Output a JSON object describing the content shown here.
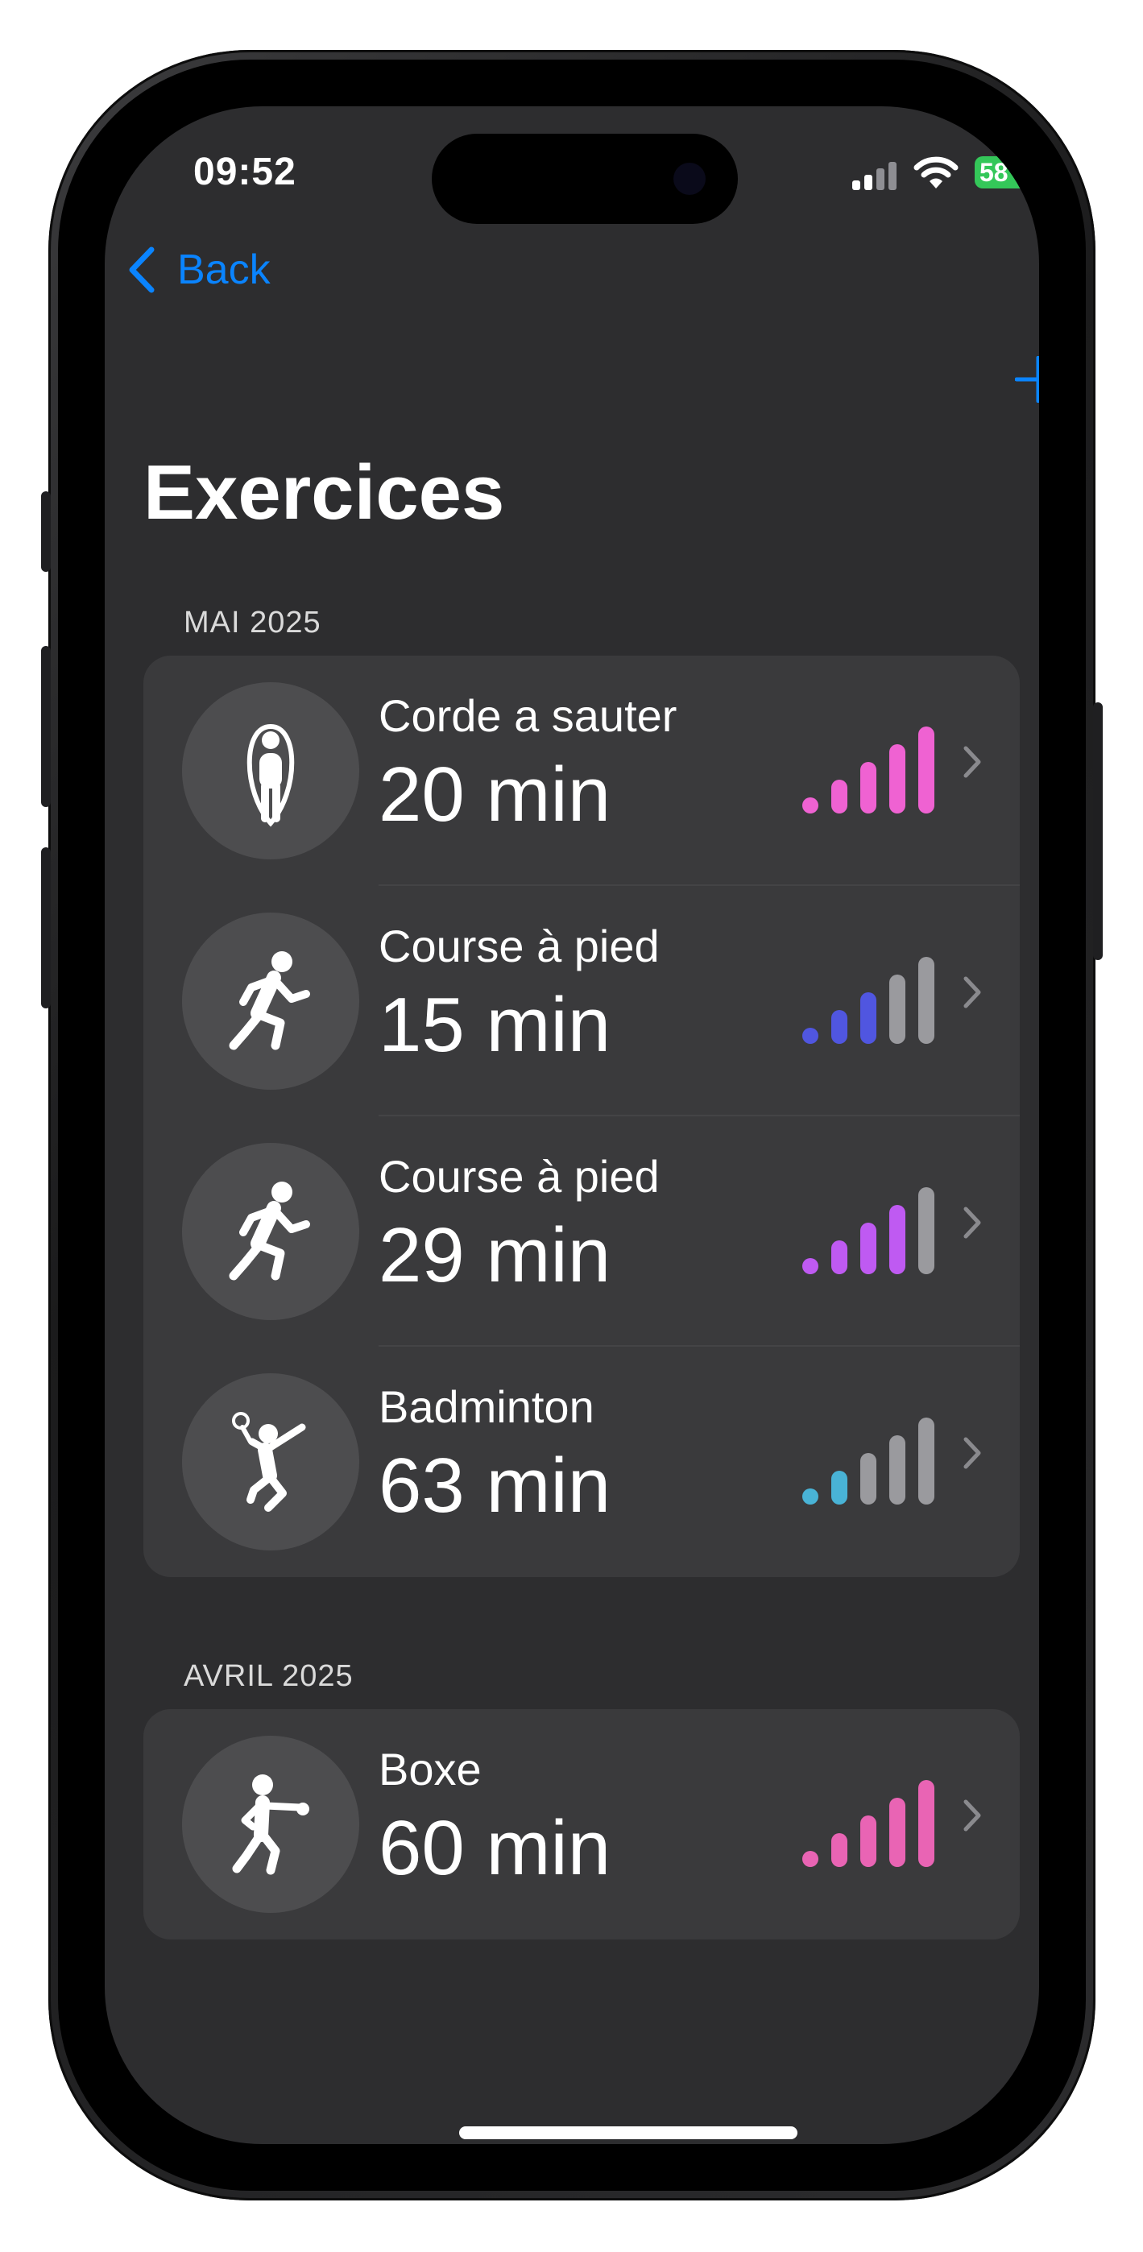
{
  "status_bar": {
    "time": "09:52",
    "battery": "58"
  },
  "nav": {
    "back_label": "Back",
    "add_icon": "plus-icon"
  },
  "page": {
    "title": "Exercices"
  },
  "accent_color": "#0a84ff",
  "sections": [
    {
      "label": "MAI 2025",
      "items": [
        {
          "name": "Corde a sauter",
          "duration": "20 min",
          "icon": "jump-rope-icon",
          "intensity": 5,
          "color": "#ef62d2"
        },
        {
          "name": "Course à pied",
          "duration": "15 min",
          "icon": "running-icon",
          "intensity": 3,
          "color": "#5056e0"
        },
        {
          "name": "Course à pied",
          "duration": "29 min",
          "icon": "running-icon",
          "intensity": 4,
          "color": "#bf5af2"
        },
        {
          "name": "Badminton",
          "duration": "63 min",
          "icon": "badminton-icon",
          "intensity": 2,
          "color": "#49b3d6"
        }
      ]
    },
    {
      "label": "AVRIL 2025",
      "items": [
        {
          "name": "Boxe",
          "duration": "60 min",
          "icon": "boxing-icon",
          "intensity": 5,
          "color": "#e964b4"
        }
      ]
    }
  ]
}
